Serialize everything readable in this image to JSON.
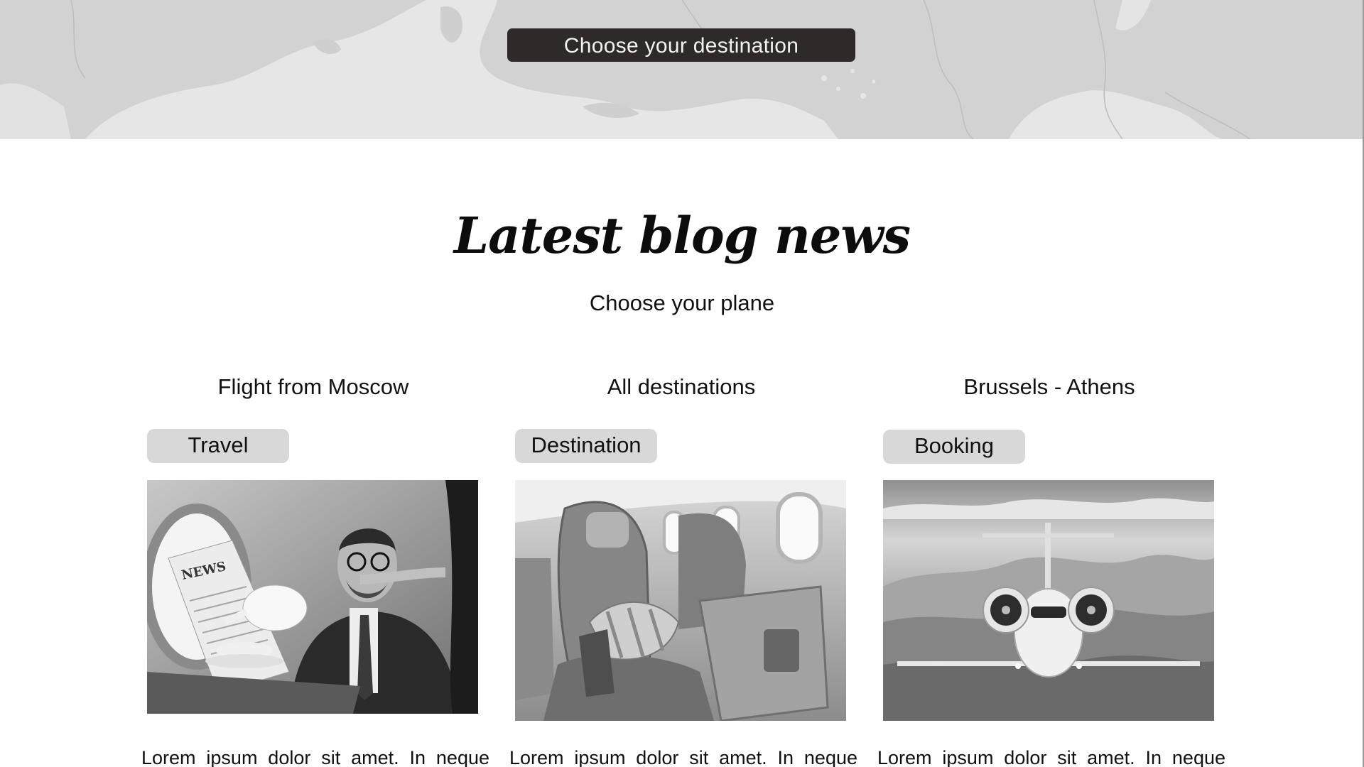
{
  "banner": {
    "cta_label": "Choose your destination"
  },
  "blog": {
    "title": "Latest blog news",
    "subtitle": "Choose your plane"
  },
  "cards": [
    {
      "title": "Flight from Moscow",
      "tag": "Travel",
      "image_desc": "businessman-reading-newspaper-image",
      "excerpt": "Lorem ipsum dolor sit amet. In neque"
    },
    {
      "title": "All destinations",
      "tag": "Destination",
      "image_desc": "airplane-seat-interior-image",
      "excerpt": "Lorem ipsum dolor sit amet. In neque"
    },
    {
      "title": "Brussels - Athens",
      "tag": "Booking",
      "image_desc": "private-jet-flying-image",
      "excerpt": "Lorem ipsum dolor sit amet. In neque"
    }
  ],
  "colors": {
    "banner_bg": "#d3d3d3",
    "cta_bg": "#2f2a29",
    "tag_bg": "#d8d8d8"
  }
}
